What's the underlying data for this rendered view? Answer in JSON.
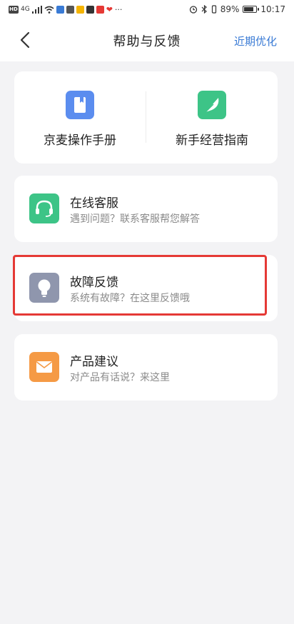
{
  "status_bar": {
    "time": "10:17",
    "battery": "89%",
    "battery_level": 0.89,
    "network": "4G"
  },
  "header": {
    "back_icon": "chevron-left-icon",
    "title": "帮助与反馈",
    "action_label": "近期优化"
  },
  "manuals": [
    {
      "label": "京麦操作手册",
      "icon": "book-icon",
      "color": "#5b8def"
    },
    {
      "label": "新手经营指南",
      "icon": "compass-leaf-icon",
      "color": "#3dc487"
    }
  ],
  "items": [
    {
      "title": "在线客服",
      "subtitle": "遇到问题？联系客服帮您解答",
      "icon": "headset-icon",
      "color": "#3dc487"
    },
    {
      "title": "故障反馈",
      "subtitle": "系统有故障？在这里反馈哦",
      "icon": "lightbulb-icon",
      "color": "#8f96ad"
    },
    {
      "title": "产品建议",
      "subtitle": "对产品有话说？来这里",
      "icon": "envelope-icon",
      "color": "#f59a45"
    }
  ],
  "colors": {
    "accent": "#3a7bd5",
    "highlight": "#e53935",
    "background": "#f3f3f5"
  }
}
